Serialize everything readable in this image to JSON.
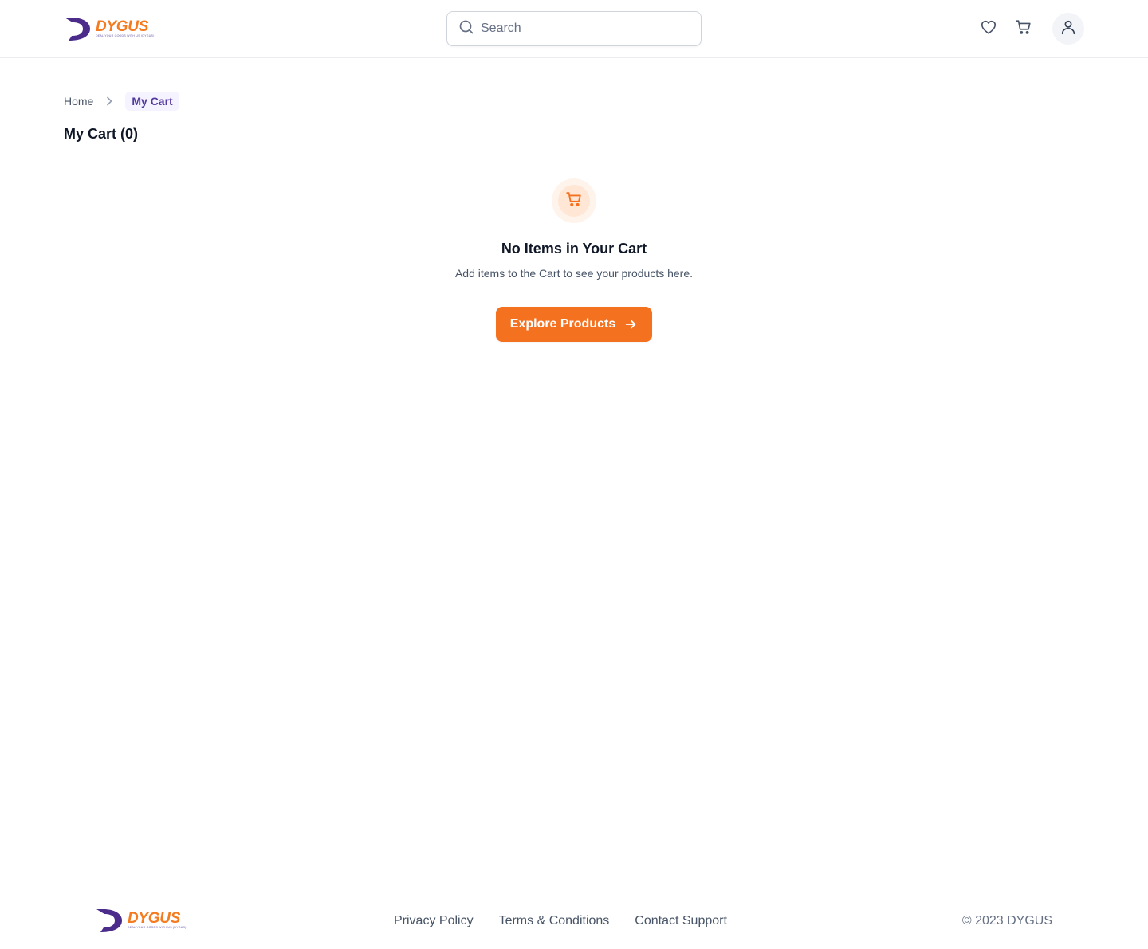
{
  "brand": {
    "name": "DYGUS",
    "tagline": "DEAL YOUR GOODS WITH US (DYGUS)",
    "colors": {
      "orange": "#f47120",
      "purple": "#4b2c8a"
    }
  },
  "header": {
    "search": {
      "placeholder": "Search",
      "value": ""
    },
    "icons": {
      "wishlist": "heart-icon",
      "cart": "cart-icon",
      "account": "user-icon"
    }
  },
  "breadcrumb": {
    "items": [
      {
        "label": "Home"
      },
      {
        "label": "My Cart"
      }
    ]
  },
  "page": {
    "title": "My Cart (0)"
  },
  "empty_state": {
    "icon": "cart-icon",
    "title": "No Items in Your Cart",
    "description": "Add items to the Cart to see your products here.",
    "button_label": "Explore Products"
  },
  "footer": {
    "links": [
      {
        "label": "Privacy Policy"
      },
      {
        "label": "Terms & Conditions"
      },
      {
        "label": "Contact Support"
      }
    ],
    "copyright": "© 2023 DYGUS"
  }
}
